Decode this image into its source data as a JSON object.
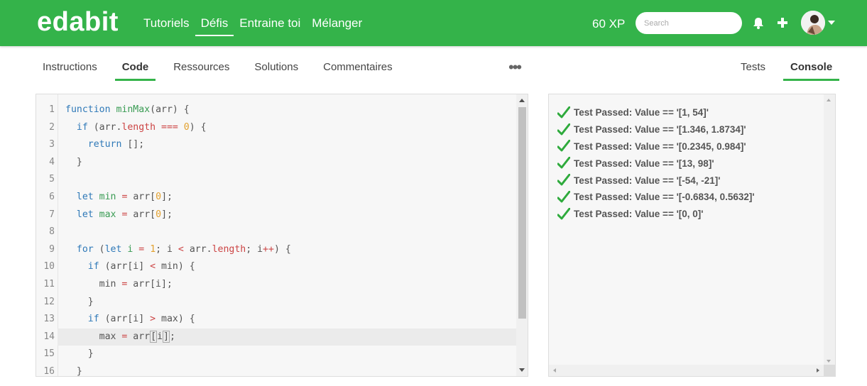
{
  "header": {
    "logo": "edabit",
    "nav": [
      "Tutoriels",
      "Défis",
      "Entraine toi",
      "Mélanger"
    ],
    "active_nav": "Défis",
    "xp": "60 XP",
    "search_placeholder": "Search",
    "icons": [
      "bell-icon",
      "plus-icon",
      "avatar",
      "chevron-down-icon"
    ],
    "brand_color": "#34b34a"
  },
  "tabs": {
    "left": [
      "Instructions",
      "Code",
      "Ressources",
      "Solutions",
      "Commentaires"
    ],
    "active_left": "Code",
    "more": "•••",
    "right": [
      "Tests",
      "Console"
    ],
    "active_right": "Console"
  },
  "editor": {
    "active_line": 14,
    "lines": [
      {
        "n": "1",
        "code": "function minMax(arr) {"
      },
      {
        "n": "2",
        "code": "  if (arr.length === 0) {"
      },
      {
        "n": "3",
        "code": "    return [];"
      },
      {
        "n": "4",
        "code": "  }"
      },
      {
        "n": "5",
        "code": ""
      },
      {
        "n": "6",
        "code": "  let min = arr[0];"
      },
      {
        "n": "7",
        "code": "  let max = arr[0];"
      },
      {
        "n": "8",
        "code": ""
      },
      {
        "n": "9",
        "code": "  for (let i = 1; i < arr.length; i++) {"
      },
      {
        "n": "10",
        "code": "    if (arr[i] < min) {"
      },
      {
        "n": "11",
        "code": "      min = arr[i];"
      },
      {
        "n": "12",
        "code": "    }"
      },
      {
        "n": "13",
        "code": "    if (arr[i] > max) {"
      },
      {
        "n": "14",
        "code": "      max = arr[i];"
      },
      {
        "n": "15",
        "code": "    }"
      },
      {
        "n": "16",
        "code": "  }"
      }
    ]
  },
  "console": {
    "results": [
      "Test Passed: Value == '[1, 54]'",
      "Test Passed: Value == '[1.346, 1.8734]'",
      "Test Passed: Value == '[0.2345, 0.984]'",
      "Test Passed: Value == '[13, 98]'",
      "Test Passed: Value == '[-54, -21]'",
      "Test Passed: Value == '[-0.6834, 0.5632]'",
      "Test Passed: Value == '[0, 0]'"
    ],
    "check_color": "#2eaa3c"
  }
}
